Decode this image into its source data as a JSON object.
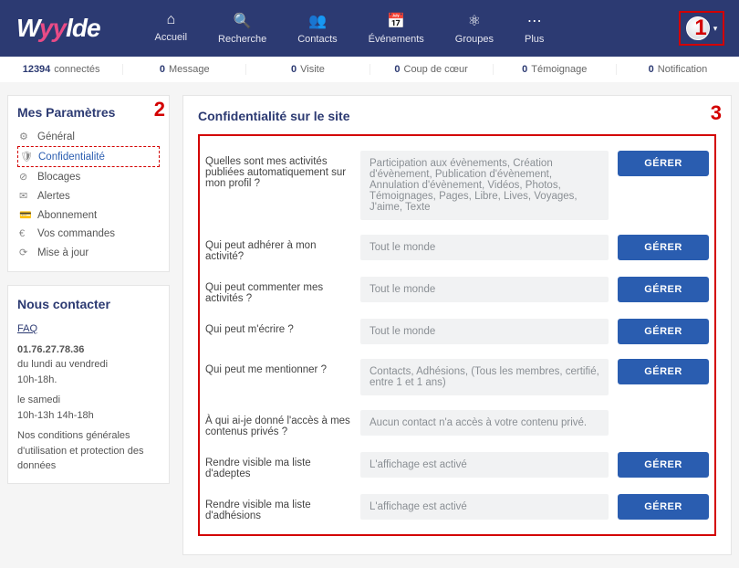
{
  "brand": {
    "part1": "W",
    "part2": "yy",
    "part3": "lde"
  },
  "nav": {
    "items": [
      {
        "icon": "⌂",
        "label": "Accueil"
      },
      {
        "icon": "🔍",
        "label": "Recherche"
      },
      {
        "icon": "👥",
        "label": "Contacts"
      },
      {
        "icon": "📅",
        "label": "Événements"
      },
      {
        "icon": "⚛",
        "label": "Groupes"
      },
      {
        "icon": "⋯",
        "label": "Plus"
      }
    ]
  },
  "markers": {
    "one": "1",
    "two": "2",
    "three": "3"
  },
  "stats": [
    {
      "num": "12394",
      "label": "connectés"
    },
    {
      "num": "0",
      "label": "Message"
    },
    {
      "num": "0",
      "label": "Visite"
    },
    {
      "num": "0",
      "label": "Coup de cœur"
    },
    {
      "num": "0",
      "label": "Témoignage"
    },
    {
      "num": "0",
      "label": "Notification"
    }
  ],
  "sidebar": {
    "title": "Mes Paramètres",
    "items": [
      {
        "icon": "⚙",
        "label": "Général"
      },
      {
        "icon": "🛡",
        "label": "Confidentialité"
      },
      {
        "icon": "⊘",
        "label": "Blocages"
      },
      {
        "icon": "✉",
        "label": "Alertes"
      },
      {
        "icon": "💳",
        "label": "Abonnement"
      },
      {
        "icon": "€",
        "label": "Vos commandes"
      },
      {
        "icon": "⟳",
        "label": "Mise à jour"
      }
    ]
  },
  "contact": {
    "title": "Nous contacter",
    "faq": "FAQ",
    "phone": "01.76.27.78.36",
    "week": "du lundi au vendredi",
    "week_hours": "10h-18h.",
    "sat": "le samedi",
    "sat_hours": "10h-13h 14h-18h",
    "terms": "Nos conditions générales d'utilisation et protection des données"
  },
  "main": {
    "title": "Confidentialité sur le site",
    "manage": "GÉRER",
    "rows": [
      {
        "q": "Quelles sont mes activités publiées automatiquement sur mon profil ?",
        "v": "Participation aux évènements, Création d'évènement, Publication d'évènement, Annulation d'évènement, Vidéos, Photos, Témoignages, Pages, Libre, Lives, Voyages, J'aime, Texte",
        "btn": true
      },
      {
        "q": "Qui peut adhérer à mon activité?",
        "v": "Tout le monde",
        "btn": true
      },
      {
        "q": "Qui peut commenter mes activités ?",
        "v": "Tout le monde",
        "btn": true
      },
      {
        "q": "Qui peut m'écrire ?",
        "v": "Tout le monde",
        "btn": true
      },
      {
        "q": "Qui peut me mentionner ?",
        "v": "Contacts, Adhésions, (Tous les membres, certifié, entre 1 et 1 ans)",
        "btn": true
      },
      {
        "q": "À qui ai-je donné l'accès à mes contenus privés ?",
        "v": "Aucun contact n'a accès à votre contenu privé.",
        "btn": false
      },
      {
        "q": "Rendre visible ma liste d'adeptes",
        "v": "L'affichage est activé",
        "btn": true
      },
      {
        "q": "Rendre visible ma liste d'adhésions",
        "v": "L'affichage est activé",
        "btn": true
      }
    ]
  }
}
